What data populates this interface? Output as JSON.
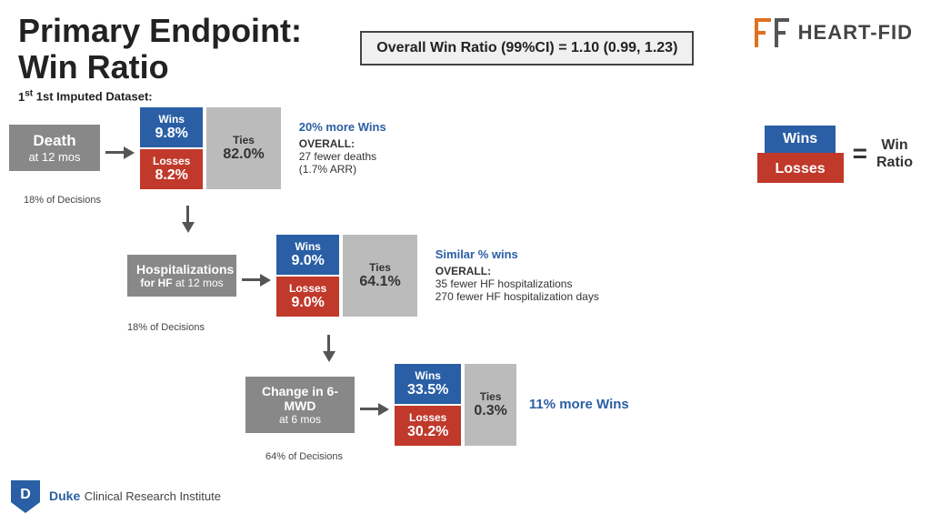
{
  "header": {
    "title_line1": "Primary Endpoint:",
    "title_line2": "Win Ratio",
    "overall_label": "Overall Win Ratio (99%CI) = 1.10 (0.99, 1.23)",
    "logo_text": "HEART-FID",
    "logo_icon": "Fe"
  },
  "dataset": {
    "label": "1st Imputed Dataset:"
  },
  "death": {
    "title": "Death",
    "subtitle": "at 12 mos",
    "decisions": "18% of Decisions"
  },
  "hosp": {
    "title": "Hospitalizations",
    "bold": "for HF",
    "subtitle": "at 12 mos",
    "decisions": "18% of Decisions"
  },
  "mwd": {
    "title": "Change in 6-MWD",
    "subtitle": "at 6 mos",
    "decisions": "64% of Decisions"
  },
  "block1": {
    "wins_label": "Wins",
    "wins_pct": "9.8%",
    "losses_label": "Losses",
    "losses_pct": "8.2%",
    "ties_label": "Ties",
    "ties_pct": "82.0%"
  },
  "block2": {
    "wins_label": "Wins",
    "wins_pct": "9.0%",
    "losses_label": "Losses",
    "losses_pct": "9.0%",
    "ties_label": "Ties",
    "ties_pct": "64.1%"
  },
  "block3": {
    "wins_label": "Wins",
    "wins_pct": "33.5%",
    "losses_label": "Losses",
    "losses_pct": "30.2%",
    "ties_label": "Ties",
    "ties_pct": "0.3%"
  },
  "annotation1": {
    "wins_note": "20% more Wins",
    "overall_label": "OVERALL:",
    "detail1": "27 fewer deaths",
    "detail2": "(1.7% ARR)"
  },
  "annotation2": {
    "wins_note": "Similar % wins",
    "overall_label": "OVERALL:",
    "detail1": "35 fewer HF hospitalizations",
    "detail2": "270 fewer HF hospitalization days"
  },
  "annotation3": {
    "wins_note": "11% more Wins"
  },
  "formula": {
    "wins_label": "Wins",
    "losses_label": "Losses",
    "equals": "=",
    "result_line1": "Win",
    "result_line2": "Ratio"
  },
  "duke": {
    "logo_letter": "D",
    "name": "Duke",
    "subtitle": "Clinical Research Institute"
  }
}
